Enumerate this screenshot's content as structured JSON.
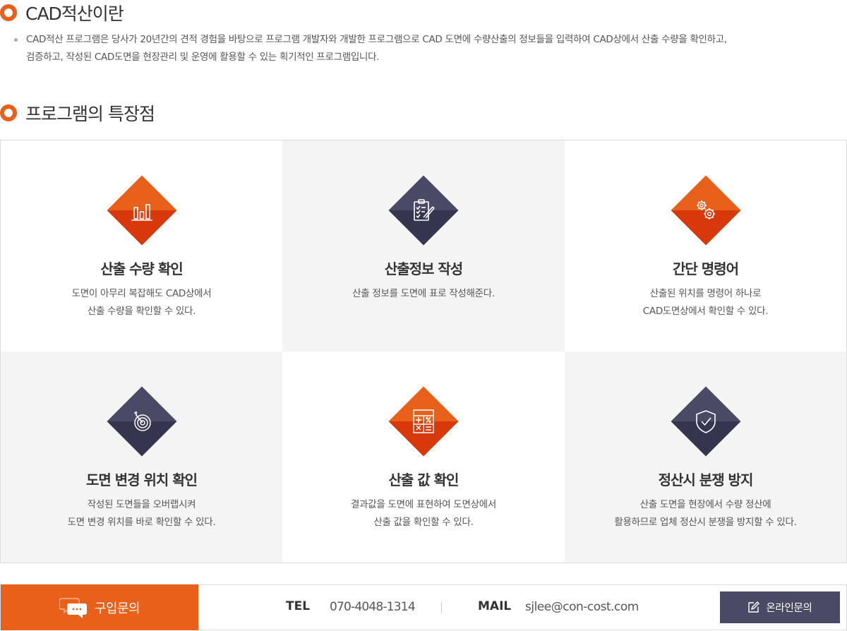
{
  "section1": {
    "title": "CAD적산이란",
    "intro_line1": "CAD적산 프로그램은 당사가 20년간의 견적 경험을 바탕으로 프로그램 개발자와 개발한 프로그램으로 CAD 도면에 수량산출의 정보들을 입력하여 CAD상에서 산출 수량을 확인하고,",
    "intro_line2": "검증하고, 작성된 CAD도면을 현장관리 및 운영에 활용할 수 있는 획기적인 프로그램입니다."
  },
  "section2": {
    "title": "프로그램의 특장점"
  },
  "features": [
    {
      "title": "산출 수량 확인",
      "desc1": "도면이 아무리 복잡해도 CAD상에서",
      "desc2": "산출 수량을 확인할 수 있다.",
      "icon": "bar-chart-icon",
      "color": "orange"
    },
    {
      "title": "산출정보 작성",
      "desc1": "산출 정보를 도면에 표로 작성해준다.",
      "desc2": "",
      "icon": "clipboard-pen-icon",
      "color": "navy"
    },
    {
      "title": "간단 명령어",
      "desc1": "산출된 위치를 명령어 하나로",
      "desc2": "CAD도면상에서 확인할 수 있다.",
      "icon": "gears-icon",
      "color": "orange"
    },
    {
      "title": "도면 변경 위치 확인",
      "desc1": "작성된 도면들을 오버랩시켜",
      "desc2": "도면 변경 위치를 바로 확인할 수 있다.",
      "icon": "target-icon",
      "color": "navy"
    },
    {
      "title": "산출 값 확인",
      "desc1": "결과값을 도면에 표현하여 도면상에서",
      "desc2": "산출 값을 확인할 수 있다.",
      "icon": "calculator-icon",
      "color": "orange"
    },
    {
      "title": "정산시 분쟁 방지",
      "desc1": "산출 도면을 현장에서 수량 정산에",
      "desc2": "활용하므로 업체 정산시 분쟁을 방지할 수 있다.",
      "icon": "shield-check-icon",
      "color": "navy"
    }
  ],
  "footer": {
    "buy_label": "구입문의",
    "buy_icon": "chat-bubble-icon",
    "tel_label": "TEL",
    "tel_value": "070-4048-1314",
    "mail_label": "MAIL",
    "mail_value": "sjlee@con-cost.com",
    "online_label": "온라인문의",
    "online_icon": "edit-icon"
  },
  "colors": {
    "accent": "#e8601a",
    "accent_dark": "#d8380a",
    "navy": "#4b4a66",
    "navy_dark": "#36354f"
  }
}
